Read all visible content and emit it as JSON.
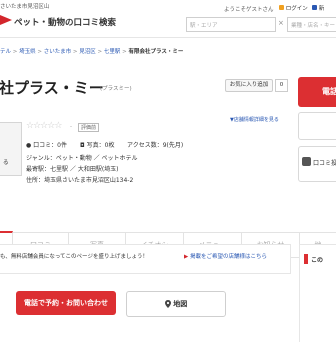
{
  "header": {
    "top_left": "さいたま市見沼区山",
    "site_name": "ペット・動物の口コミ検索",
    "greeting": "ようこそゲストさん",
    "login": "ログイン",
    "register": "新",
    "search_area_placeholder": "駅・エリア",
    "search_keyword_placeholder": "業種・店名・キー"
  },
  "breadcrumb": [
    "テル",
    "埼玉県",
    "さいたま市",
    "見沼区",
    "七里駅",
    "有限会社プラス・ミー"
  ],
  "shop": {
    "name": "社プラス・ミー",
    "kana": "(プラスミー)",
    "favorite_label": "お気に入り追加",
    "favorite_count": "0",
    "correction_link": "▼店舗情報詳細を見る",
    "rating_badge": "評価前",
    "reviews_label": "口コミ：0件",
    "photos_label": "写真：0枚",
    "access_label": "アクセス数：9(先月)",
    "genre": "ジャンル：ペット・動物 ／ ペットホテル",
    "station": "最寄駅：七里駅 ／ 大和田駅(埼玉)",
    "address": "住所：埼玉県さいたま市見沼区山134-2",
    "left_button": "る"
  },
  "side": {
    "top_button": "電話",
    "review_post": "口コミ投稿"
  },
  "tabs": [
    "",
    "口コミ",
    "写真",
    "イチオシ",
    "メニュー",
    "お知らせ",
    "地"
  ],
  "notice": {
    "text": "も、無料店舗会員になってこのページを盛り上げましょう！",
    "link": "掲載をご希望の店舗様はこちら",
    "right_text": "この"
  },
  "actions": {
    "call": "電話で予約・お問い合わせ",
    "map": "地図"
  },
  "colors": {
    "accent": "#dc2f32",
    "link": "#2a58b3"
  }
}
